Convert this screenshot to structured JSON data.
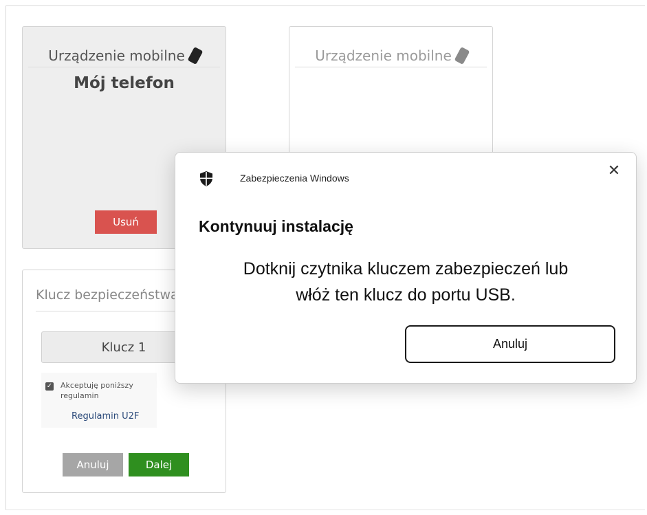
{
  "mobile_cards": [
    {
      "title": "Urządzenie mobilne",
      "device_name": "Mój telefon",
      "remove_label": "Usuń"
    },
    {
      "title": "Urządzenie mobilne"
    }
  ],
  "security_key_card": {
    "title": "Klucz bezpieczeństwa",
    "selected_key": "Klucz 1",
    "terms_checkbox_label": "Akceptuję poniższy regulamin",
    "terms_checked": true,
    "terms_link": "Regulamin U2F",
    "cancel_label": "Anuluj",
    "next_label": "Dalej"
  },
  "dialog": {
    "app_name": "Zabezpieczenia Windows",
    "title": "Kontynuuj instalację",
    "message_line1": "Dotknij czytnika kluczem zabezpieczeń lub",
    "message_line2": "włóż ten klucz do portu USB.",
    "cancel_label": "Anuluj",
    "close_icon": "close-icon",
    "shield_icon": "shield-icon"
  },
  "colors": {
    "danger": "#d9534f",
    "success": "#2f8f1f",
    "muted_button": "#a6a6a6"
  }
}
